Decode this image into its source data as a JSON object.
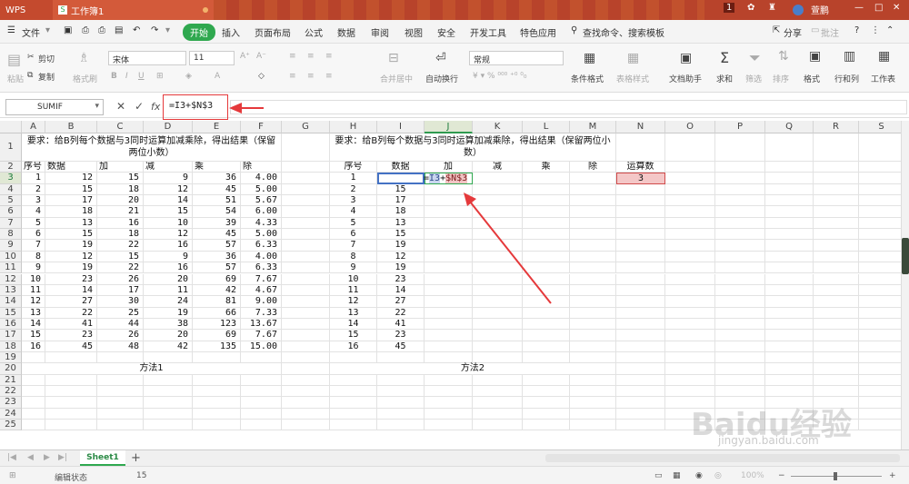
{
  "titlebar": {
    "app": "WPS",
    "book": "工作簿1",
    "badge": "1",
    "user": "萱鹏"
  },
  "menu": {
    "file": "文件",
    "items": [
      "开始",
      "插入",
      "页面布局",
      "公式",
      "数据",
      "审阅",
      "视图",
      "安全",
      "开发工具",
      "特色应用"
    ],
    "search": "查找命令、搜索模板",
    "share": "分享",
    "comment": "批注"
  },
  "ribbon": {
    "paste": "粘贴",
    "cut": "剪切",
    "copy": "复制",
    "format_painter": "格式刷",
    "font": "宋体",
    "size": "11",
    "merge": "合并居中",
    "wrap": "自动换行",
    "numfmt": "常规",
    "cond": "条件格式",
    "table_style": "表格样式",
    "doc_helper": "文档助手",
    "sum": "求和",
    "filter": "筛选",
    "sort": "排序",
    "format": "格式",
    "rowcol": "行和列",
    "sheet": "工作表"
  },
  "formula_bar": {
    "namebox": "SUMIF",
    "formula": "=I3+$N$3",
    "fx": "fx"
  },
  "columns": [
    "A",
    "B",
    "C",
    "D",
    "E",
    "F",
    "G",
    "H",
    "I",
    "J",
    "K",
    "L",
    "M",
    "N",
    "O",
    "P",
    "Q",
    "R",
    "S"
  ],
  "rows": [
    "1",
    "2",
    "3",
    "4",
    "5",
    "6",
    "7",
    "8",
    "9",
    "10",
    "11",
    "12",
    "13",
    "14",
    "15",
    "16",
    "17",
    "18",
    "19",
    "20",
    "21",
    "22",
    "23",
    "24",
    "25"
  ],
  "method1": {
    "title": "要求：给B列每个数据与3同时运算加减乘除，得出结果（保留两位小数）",
    "headers": [
      "序号",
      "数据",
      "加",
      "减",
      "乘",
      "除"
    ],
    "data": [
      [
        "1",
        "12",
        "15",
        "9",
        "36",
        "4.00"
      ],
      [
        "2",
        "15",
        "18",
        "12",
        "45",
        "5.00"
      ],
      [
        "3",
        "17",
        "20",
        "14",
        "51",
        "5.67"
      ],
      [
        "4",
        "18",
        "21",
        "15",
        "54",
        "6.00"
      ],
      [
        "5",
        "13",
        "16",
        "10",
        "39",
        "4.33"
      ],
      [
        "6",
        "15",
        "18",
        "12",
        "45",
        "5.00"
      ],
      [
        "7",
        "19",
        "22",
        "16",
        "57",
        "6.33"
      ],
      [
        "8",
        "12",
        "15",
        "9",
        "36",
        "4.00"
      ],
      [
        "9",
        "19",
        "22",
        "16",
        "57",
        "6.33"
      ],
      [
        "10",
        "23",
        "26",
        "20",
        "69",
        "7.67"
      ],
      [
        "11",
        "14",
        "17",
        "11",
        "42",
        "4.67"
      ],
      [
        "12",
        "27",
        "30",
        "24",
        "81",
        "9.00"
      ],
      [
        "13",
        "22",
        "25",
        "19",
        "66",
        "7.33"
      ],
      [
        "14",
        "41",
        "44",
        "38",
        "123",
        "13.67"
      ],
      [
        "15",
        "23",
        "26",
        "20",
        "69",
        "7.67"
      ],
      [
        "16",
        "45",
        "48",
        "42",
        "135",
        "15.00"
      ]
    ],
    "label": "方法1"
  },
  "method2": {
    "title": "要求：给B列每个数据与3同时运算加减乘除，得出结果（保留两位小数）",
    "headers": [
      "序号",
      "数据",
      "加",
      "减",
      "乘",
      "除",
      "运算数"
    ],
    "operand": "3",
    "seq": [
      "1",
      "2",
      "3",
      "4",
      "5",
      "6",
      "7",
      "8",
      "9",
      "10",
      "11",
      "12",
      "13",
      "14",
      "15",
      "16"
    ],
    "data": [
      "",
      "15",
      "17",
      "18",
      "13",
      "15",
      "19",
      "12",
      "19",
      "23",
      "14",
      "27",
      "22",
      "41",
      "23",
      "45"
    ],
    "editing": {
      "eq": "=",
      "ref1": "I3",
      "op": "+",
      "ref2": "$N$3"
    },
    "label": "方法2"
  },
  "sheets": {
    "active": "Sheet1",
    "add": "+"
  },
  "status": {
    "mode": "编辑状态",
    "value": "15",
    "zoom": "100%"
  },
  "watermark": {
    "logo": "Baidu经验",
    "url": "jingyan.baidu.com"
  }
}
